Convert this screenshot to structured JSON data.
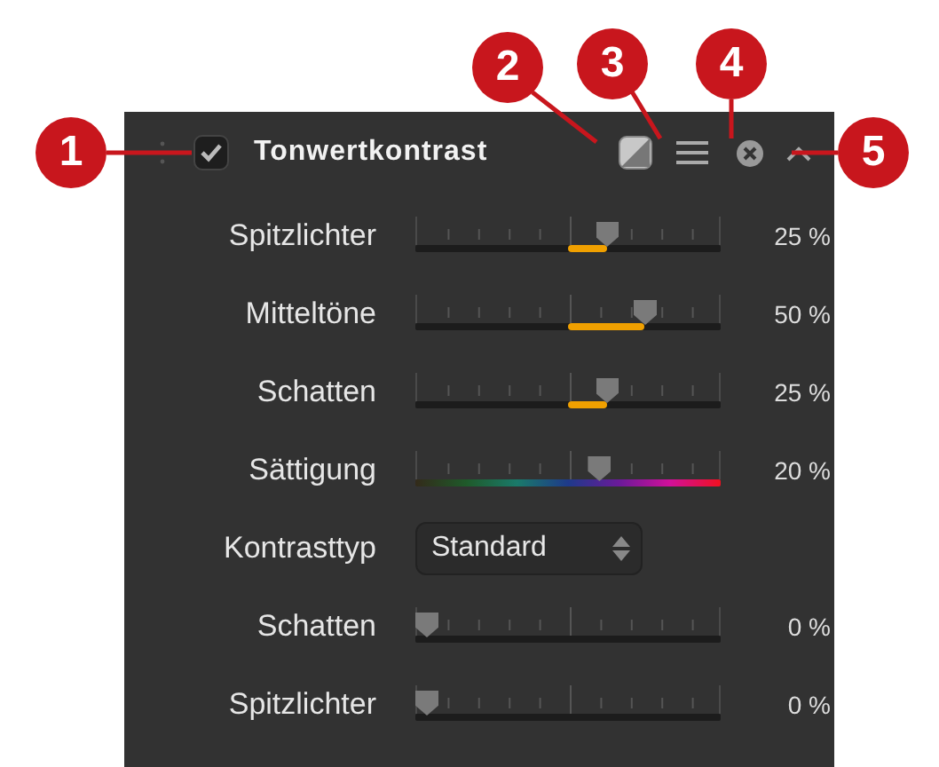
{
  "panel": {
    "title": "Tonwertkontrast",
    "enabled": true
  },
  "rows": [
    {
      "kind": "bipolar",
      "label": "Spitzlichter",
      "level": 0.625,
      "reading": "25 %"
    },
    {
      "kind": "bipolar",
      "label": "Mitteltöne",
      "level": 0.75,
      "reading": "50 %"
    },
    {
      "kind": "bipolar",
      "label": "Schatten",
      "level": 0.625,
      "reading": "25 %"
    },
    {
      "kind": "saturation",
      "label": "Sättigung",
      "level": 0.6,
      "reading": "20 %"
    },
    {
      "kind": "select",
      "label": "Kontrasttyp",
      "value": "Standard"
    },
    {
      "kind": "plain",
      "label": "Schatten",
      "level": 0,
      "reading": "0 %"
    },
    {
      "kind": "plain",
      "label": "Spitzlichter",
      "level": 0,
      "reading": "0 %"
    }
  ],
  "callouts": [
    {
      "number": "1",
      "kind": "checkbox"
    },
    {
      "number": "2",
      "kind": "compare"
    },
    {
      "number": "3",
      "kind": "menu"
    },
    {
      "number": "4",
      "kind": "close"
    },
    {
      "number": "5",
      "kind": "collapse"
    }
  ]
}
